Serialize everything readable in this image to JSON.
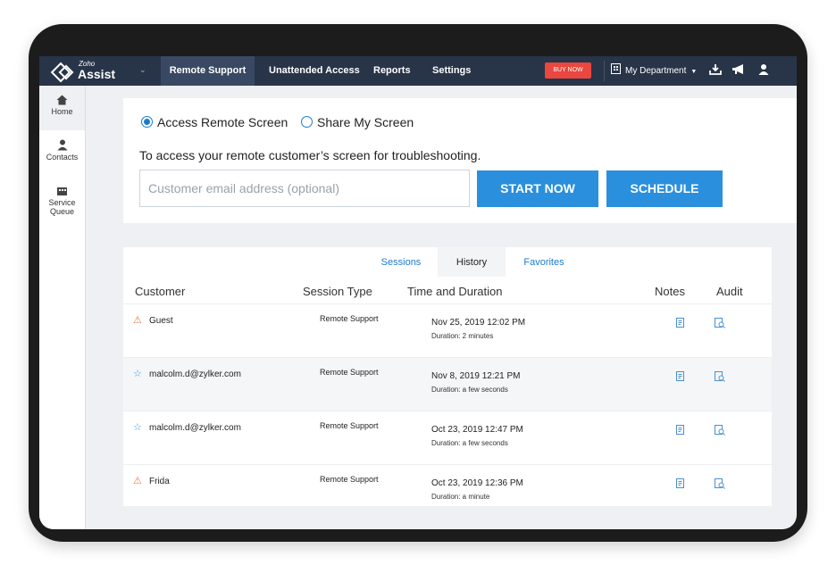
{
  "brand": {
    "zoho": "Zoho",
    "assist": "Assist"
  },
  "nav": {
    "items": [
      {
        "label": "Remote Support",
        "active": true
      },
      {
        "label": "Unattended Access",
        "active": false
      },
      {
        "label": "Reports",
        "active": false
      },
      {
        "label": "Settings",
        "active": false
      }
    ],
    "buy_now": "BUY NOW",
    "department": "My Department"
  },
  "sidebar": {
    "items": [
      {
        "label": "Home",
        "icon": "home-icon"
      },
      {
        "label": "Contacts",
        "icon": "contacts-icon"
      },
      {
        "label": "Service",
        "label2": "Queue",
        "icon": "service-queue-icon"
      }
    ]
  },
  "access": {
    "option_access": "Access Remote Screen",
    "option_share": "Share My Screen",
    "selected": "access",
    "description": "To access your remote customer’s screen for troubleshooting.",
    "email_placeholder": "Customer email address (optional)",
    "email_value": "",
    "start_label": "START NOW",
    "schedule_label": "SCHEDULE"
  },
  "history": {
    "tabs": [
      {
        "label": "Sessions",
        "active": false
      },
      {
        "label": "History",
        "active": true
      },
      {
        "label": "Favorites",
        "active": false
      }
    ],
    "columns": {
      "customer": "Customer",
      "session_type": "Session Type",
      "time": "Time and Duration",
      "notes": "Notes",
      "audit": "Audit"
    },
    "rows": [
      {
        "customer": "Guest",
        "icon": "warning-icon",
        "session_type": "Remote Support",
        "date": "Nov 25, 2019 12:02 PM",
        "duration": "Duration: 2 minutes"
      },
      {
        "customer": "malcolm.d@zylker.com",
        "icon": "star-icon",
        "session_type": "Remote Support",
        "date": "Nov 8, 2019 12:21 PM",
        "duration": "Duration: a few seconds"
      },
      {
        "customer": "malcolm.d@zylker.com",
        "icon": "star-icon",
        "session_type": "Remote Support",
        "date": "Oct 23, 2019 12:47 PM",
        "duration": "Duration: a few seconds"
      },
      {
        "customer": "Frida",
        "icon": "warning-icon",
        "session_type": "Remote Support",
        "date": "Oct 23, 2019 12:36 PM",
        "duration": "Duration: a minute"
      }
    ]
  },
  "colors": {
    "topbar": "#283448",
    "accent": "#2a8fdc",
    "buy_now": "#e9473f",
    "link": "#1a7ccf"
  }
}
